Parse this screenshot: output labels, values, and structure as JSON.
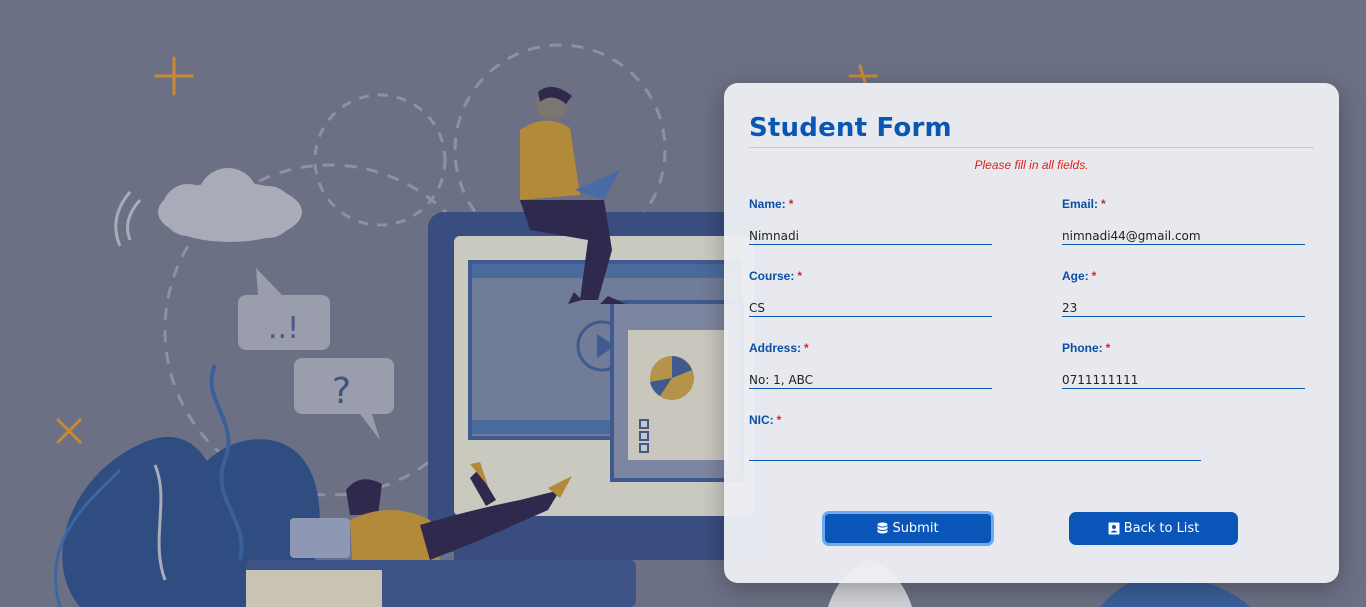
{
  "form": {
    "title": "Student Form",
    "notice": "Please fill in all fields.",
    "required_mark": "*",
    "fields": {
      "name": {
        "label": "Name:",
        "value": "Nimnadi"
      },
      "email": {
        "label": "Email:",
        "value": "nimnadi44@gmail.com"
      },
      "course": {
        "label": "Course:",
        "value": "CS"
      },
      "age": {
        "label": "Age:",
        "value": "23"
      },
      "address": {
        "label": "Address:",
        "value": "No: 1, ABC"
      },
      "phone": {
        "label": "Phone:",
        "value": "0711111111"
      },
      "nic": {
        "label": "NIC:",
        "value": ""
      }
    },
    "buttons": {
      "submit": {
        "label": "Submit",
        "icon": "database-icon"
      },
      "back": {
        "label": "Back to List",
        "icon": "address-book-icon"
      }
    }
  },
  "colors": {
    "accent": "#0a57b3",
    "required": "#e0221b",
    "background": "#6b7084"
  }
}
